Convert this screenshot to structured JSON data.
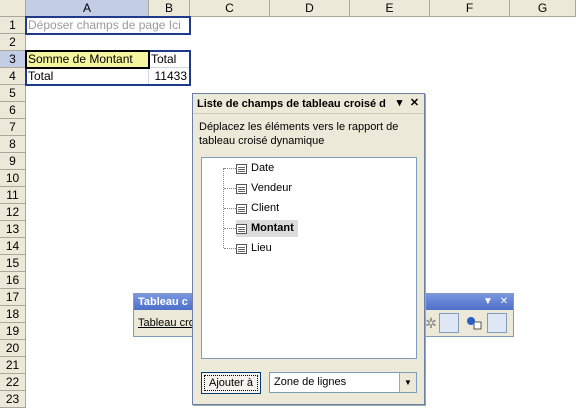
{
  "sheet": {
    "columns": [
      "A",
      "B",
      "C",
      "D",
      "E",
      "F",
      "G"
    ],
    "rows": [
      "1",
      "2",
      "3",
      "4",
      "5",
      "6",
      "7",
      "8",
      "9",
      "10",
      "11",
      "12",
      "13",
      "14",
      "15",
      "16",
      "17",
      "18",
      "19",
      "20",
      "21",
      "22",
      "23"
    ],
    "cells": {
      "A1": "Déposer champs de page Ici",
      "A3": "Somme de Montant",
      "B3": "Total",
      "A4": "Total",
      "B4": "11433"
    }
  },
  "pivot_toolbar": {
    "title": "Tableau c",
    "menu_label": "Tableau cro"
  },
  "field_list": {
    "title": "Liste de champs de tableau croisé d",
    "description": "Déplacez les éléments vers le rapport de tableau croisé dynamique",
    "fields": [
      "Date",
      "Vendeur",
      "Client",
      "Montant",
      "Lieu"
    ],
    "selected_field": "Montant",
    "add_button": "Ajouter à",
    "zone_value": "Zone de lignes"
  },
  "colors": {
    "selection_header": "#c3cde6",
    "pivot_border": "#1e3a8c",
    "toolbar_title": "#4c6fc9"
  }
}
